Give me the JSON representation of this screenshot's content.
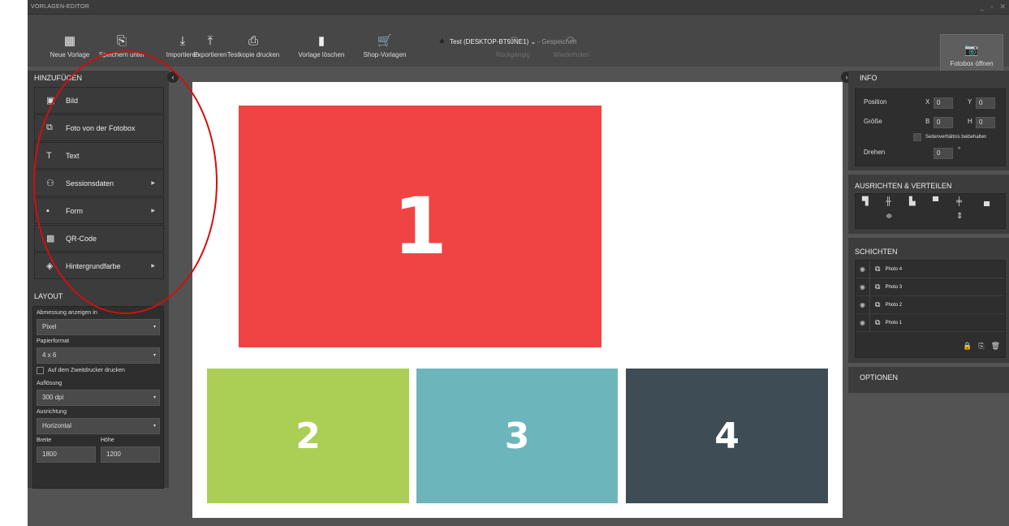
{
  "window": {
    "title": "VORLAGEN-EDITOR",
    "controls": [
      "_",
      "▫",
      "✕"
    ]
  },
  "document": {
    "star": "★",
    "name": "Test (DESKTOP-BT9JNE1)",
    "chevron": "⌄",
    "status": "- Gespeichert"
  },
  "toolbar": {
    "items": [
      {
        "label": "Neue Vorlage",
        "icon": "new-template-icon",
        "glyph": "▦"
      },
      {
        "label": "Speichern unter",
        "icon": "save-as-icon",
        "glyph": "⎘"
      },
      {
        "label": "Importieren",
        "icon": "import-icon",
        "glyph": "⤓"
      },
      {
        "label": "Exportieren",
        "icon": "export-icon",
        "glyph": "⤒"
      },
      {
        "label": "Testkopie drucken",
        "icon": "printer-icon",
        "glyph": "⎙"
      },
      {
        "label": "Vorlage löschen",
        "icon": "trash-icon",
        "glyph": "▮"
      },
      {
        "label": "Shop-Vorlagen",
        "icon": "cart-icon",
        "glyph": "🛒"
      },
      {
        "label": "Rückgängig",
        "icon": "undo-icon",
        "glyph": "↶",
        "disabled": true
      },
      {
        "label": "Wiederholen",
        "icon": "redo-icon",
        "glyph": "↷",
        "disabled": true
      }
    ],
    "fotobox_label": "Fotobox öffnen",
    "fotobox_icon": "camera-icon",
    "fotobox_glyph": "📷"
  },
  "left": {
    "add_header": "HINZUFÜGEN",
    "collapse": "‹",
    "add_items": [
      {
        "label": "Bild",
        "icon": "image-icon",
        "glyph": "▣",
        "submenu": false
      },
      {
        "label": "Foto von der Fotobox",
        "icon": "photos-icon",
        "glyph": "⧉",
        "submenu": false
      },
      {
        "label": "Text",
        "icon": "text-icon",
        "glyph": "T",
        "submenu": false
      },
      {
        "label": "Sessionsdaten",
        "icon": "session-data-icon",
        "glyph": "⚇",
        "submenu": true
      },
      {
        "label": "Form",
        "icon": "shapes-icon",
        "glyph": "▪",
        "submenu": true
      },
      {
        "label": "QR-Code",
        "icon": "qr-code-icon",
        "glyph": "▩",
        "submenu": false
      },
      {
        "label": "Hintergrundfarbe",
        "icon": "paint-bucket-icon",
        "glyph": "◈",
        "submenu": true
      }
    ],
    "submenu_arrow": "▶",
    "layout_header": "LAYOUT",
    "dimension_label": "Abmessung anzeigen in",
    "dimension_value": "Pixel",
    "paper_label": "Papierformat",
    "paper_value": "4 x 6",
    "second_printer_label": "Auf dem Zweitdrucker drucken",
    "resolution_label": "Auflösung",
    "resolution_value": "300 dpi",
    "orientation_label": "Ausrichtung",
    "orientation_value": "Horizontal",
    "width_label": "Breite",
    "width_value": "1800",
    "height_label": "Höhe",
    "height_value": "1200",
    "chevron": "▾"
  },
  "canvas": {
    "placeholders": [
      {
        "num": "1",
        "color": "#f04444"
      },
      {
        "num": "2",
        "color": "#abcf55"
      },
      {
        "num": "3",
        "color": "#6cb6bb"
      },
      {
        "num": "4",
        "color": "#3e4c55"
      }
    ]
  },
  "right": {
    "collapse": "›",
    "info_header": "INFO",
    "position_label": "Position",
    "x_label": "X",
    "x_value": "0",
    "y_label": "Y",
    "y_value": "0",
    "size_label": "Größe",
    "b_label": "B",
    "b_value": "0",
    "h_label": "H",
    "h_value": "0",
    "keep_ratio_label": "Seitenverhältnis beibehalten",
    "rotate_label": "Drehen",
    "rotate_value": "0",
    "degree": "°",
    "align_header": "AUSRICHTEN & VERTEILEN",
    "align_icons": [
      "align-left-icon",
      "align-center-horizontal-icon",
      "align-right-icon",
      "align-top-icon",
      "align-center-vertical-icon",
      "align-bottom-icon",
      "distribute-vertical-icon",
      "distribute-horizontal-icon"
    ],
    "align_glyphs": [
      "▜",
      "╫",
      "▙",
      "▀",
      "╪",
      "▄",
      "≑",
      "⇕"
    ],
    "layers_header": "SCHICHTEN",
    "layers": [
      "Photo 4",
      "Photo 3",
      "Photo 2",
      "Photo 1"
    ],
    "eye_glyph": "◉",
    "cam_glyph": "⧉",
    "layer_action_glyphs": [
      "🔒",
      "⎘",
      "🗑"
    ],
    "options_header": "OPTIONEN"
  }
}
